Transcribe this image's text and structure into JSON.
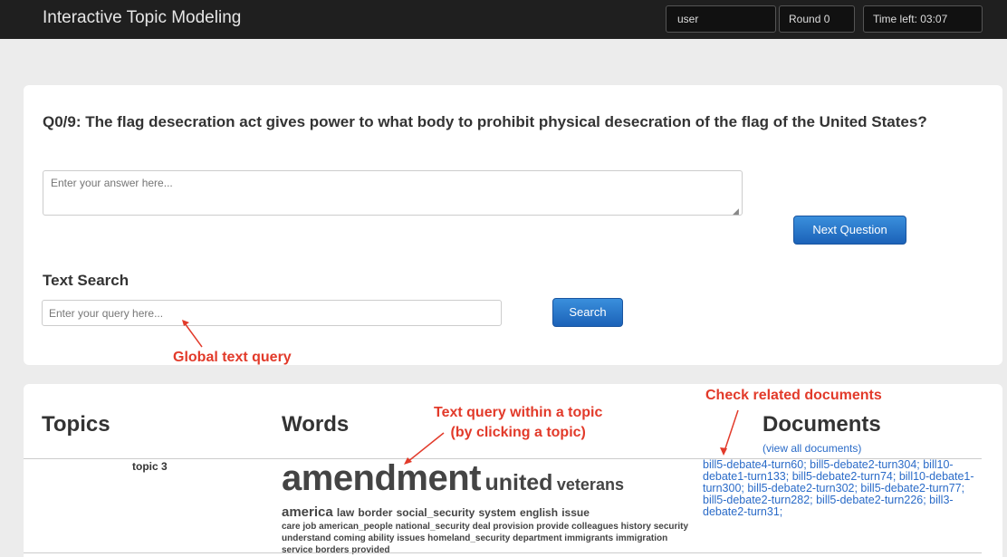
{
  "app": {
    "title": "Interactive Topic Modeling"
  },
  "nav": {
    "user": "user",
    "round": "Round 0",
    "time_left": "Time left: 03:07"
  },
  "question": {
    "text": "Q0/9: The flag desecration act gives power to what body to prohibit physical desecration of the flag of the United States?"
  },
  "answer": {
    "placeholder": "Enter your answer here..."
  },
  "buttons": {
    "next": "Next Question",
    "search": "Search"
  },
  "search": {
    "label": "Text Search",
    "placeholder": "Enter your query here..."
  },
  "annotations": {
    "global": "Global text query",
    "topic_line1": "Text query within a topic",
    "topic_line2": "(by clicking a topic)",
    "docs": "Check related documents"
  },
  "table": {
    "topics_header": "Topics",
    "words_header": "Words",
    "docs_header": "Documents",
    "view_all": "(view all documents)",
    "topic_name": "topic 3",
    "words": {
      "w1": "amendment",
      "w2": "united",
      "w3": "veterans",
      "line2": [
        "america",
        "law",
        "border",
        "social_security",
        "system",
        "english",
        "issue"
      ],
      "line3": "care job american_people national_security deal provision provide colleagues history security understand coming ability issues homeland_security department immigrants immigration service borders provided"
    },
    "documents": "bill5-debate4-turn60; bill5-debate2-turn304; bill10-debate1-turn133; bill5-debate2-turn74; bill10-debate1-turn300; bill5-debate2-turn302; bill5-debate2-turn77; bill5-debate2-turn282; bill5-debate2-turn226; bill3-debate2-turn31;"
  },
  "colors": {
    "accent": "#1c62b8",
    "annotation": "#e23a2a",
    "link": "#2a6bc8",
    "navbar": "#1f1f1f"
  }
}
